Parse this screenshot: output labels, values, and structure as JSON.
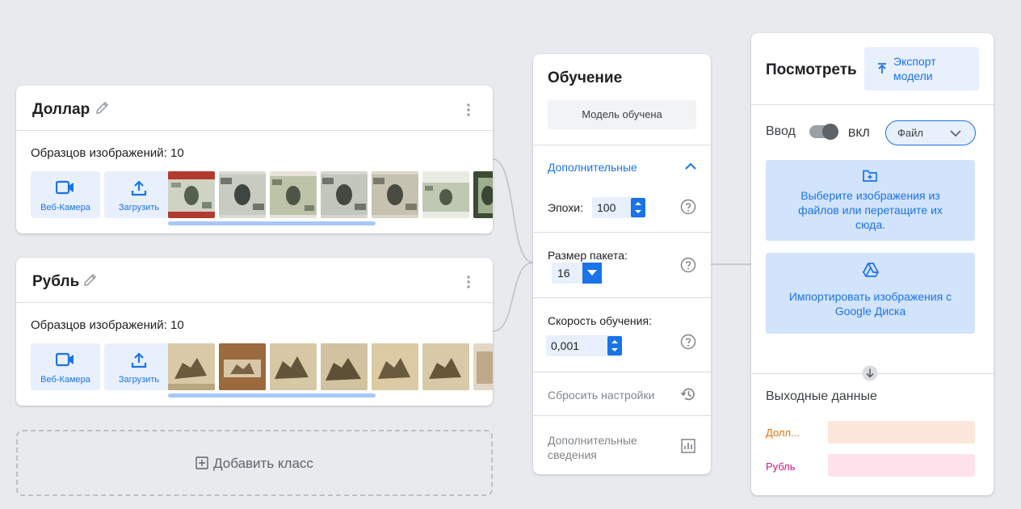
{
  "colors": {
    "accent": "#1a73e8",
    "dollar_output": "#e8710a",
    "ruble_output": "#d01884"
  },
  "classes": [
    {
      "name": "Доллар",
      "samples_label": "Образцов изображений: 10",
      "webcam_label": "Веб-Камера",
      "upload_label": "Загрузить",
      "thumbnail_type": "dollar bill",
      "thumbnail_count": 7
    },
    {
      "name": "Рубль",
      "samples_label": "Образцов изображений: 10",
      "webcam_label": "Веб-Камера",
      "upload_label": "Загрузить",
      "thumbnail_type": "ruble note",
      "thumbnail_count": 7
    }
  ],
  "add_class_label": "Добавить класс",
  "training": {
    "title": "Обучение",
    "trained_button": "Модель обучена",
    "advanced_label": "Дополнительные",
    "epochs_label": "Эпохи:",
    "epochs_value": "100",
    "batch_label": "Размер пакета:",
    "batch_value": "16",
    "lr_label": "Скорость обучения:",
    "lr_value": "0,001",
    "reset_label": "Сбросить настройки",
    "details_label": "Дополнительные сведения"
  },
  "preview": {
    "title": "Посмотреть",
    "export_label": "Экспорт модели",
    "input_label": "Ввод",
    "toggle_label": "ВКЛ",
    "toggle_on": true,
    "file_select": "Файл",
    "choose_files_text": "Выберите изображения из файлов или перетащите их сюда.",
    "google_drive_text": "Импортировать изображения с Google Диска",
    "output_title": "Выходные данные",
    "outputs": [
      {
        "label": "Долл...",
        "value": 0
      },
      {
        "label": "Рубль",
        "value": 0
      }
    ]
  }
}
